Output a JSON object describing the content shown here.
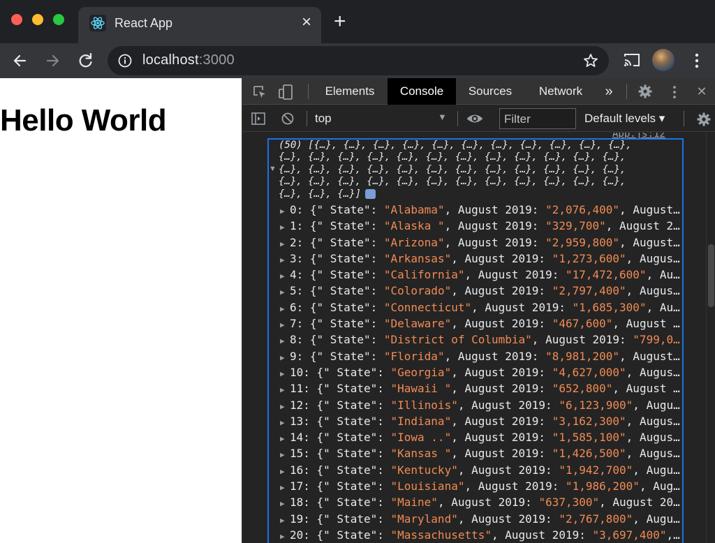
{
  "window": {
    "traffic_colors": [
      "#ff5f57",
      "#febc2e",
      "#28c840"
    ]
  },
  "tab": {
    "title": "React App",
    "close_glyph": "×",
    "icon": "react-logo-icon"
  },
  "new_tab_glyph": "+",
  "address": {
    "host": "localhost",
    "port": ":3000"
  },
  "page": {
    "heading": "Hello World"
  },
  "devtools": {
    "tabs": [
      "Elements",
      "Console",
      "Sources",
      "Network"
    ],
    "active_tab": "Console",
    "more_tabs_glyph": "»",
    "close_glyph": "✕",
    "context": "top",
    "filter_placeholder": "Filter",
    "levels": "Default levels ▾",
    "source_link": "App.js:12"
  },
  "console": {
    "summary_lines": [
      "(50) [{…}, {…}, {…}, {…}, {…}, {…}, {…}, {…}, {…}, {…}, {…},",
      "{…}, {…}, {…}, {…}, {…}, {…}, {…}, {…}, {…}, {…}, {…}, {…},",
      "{…}, {…}, {…}, {…}, {…}, {…}, {…}, {…}, {…}, {…}, {…}, {…},",
      "{…}, {…}, {…}, {…}, {…}, {…}, {…}, {…}, {…}, {…}, {…}, {…},",
      "{…}, {…}, {…}]"
    ],
    "rows": [
      {
        "index": "0",
        "state": "\"Alabama\"",
        "value": "\"2,076,400\"",
        "tail": ", August…"
      },
      {
        "index": "1",
        "state": "\"Alaska \"",
        "value": "\"329,700\"",
        "tail": ", August 2…"
      },
      {
        "index": "2",
        "state": "\"Arizona\"",
        "value": "\"2,959,800\"",
        "tail": ", August…"
      },
      {
        "index": "3",
        "state": "\"Arkansas\"",
        "value": "\"1,273,600\"",
        "tail": ", Augus…"
      },
      {
        "index": "4",
        "state": "\"California\"",
        "value": "\"17,472,600\"",
        "tail": ", Au…"
      },
      {
        "index": "5",
        "state": "\"Colorado\"",
        "value": "\"2,797,400\"",
        "tail": ", Augus…"
      },
      {
        "index": "6",
        "state": "\"Connecticut\"",
        "value": "\"1,685,300\"",
        "tail": ", Au…"
      },
      {
        "index": "7",
        "state": "\"Delaware\"",
        "value": "\"467,600\"",
        "tail": ", August …"
      },
      {
        "index": "8",
        "state": "\"District of Columbia\"",
        "value": "\"799,0…",
        "tail": ""
      },
      {
        "index": "9",
        "state": "\"Florida\"",
        "value": "\"8,981,200\"",
        "tail": ", August…"
      },
      {
        "index": "10",
        "state": "\"Georgia\"",
        "value": "\"4,627,000\"",
        "tail": ", Augus…"
      },
      {
        "index": "11",
        "state": "\"Hawaii \"",
        "value": "\"652,800\"",
        "tail": ", August …"
      },
      {
        "index": "12",
        "state": "\"Illinois\"",
        "value": "\"6,123,900\"",
        "tail": ", Augu…"
      },
      {
        "index": "13",
        "state": "\"Indiana\"",
        "value": "\"3,162,300\"",
        "tail": ", Augus…"
      },
      {
        "index": "14",
        "state": "\"Iowa ..\"",
        "value": "\"1,585,100\"",
        "tail": ", Augus…"
      },
      {
        "index": "15",
        "state": "\"Kansas \"",
        "value": "\"1,426,500\"",
        "tail": ", Augus…"
      },
      {
        "index": "16",
        "state": "\"Kentucky\"",
        "value": "\"1,942,700\"",
        "tail": ", Augu…"
      },
      {
        "index": "17",
        "state": "\"Louisiana\"",
        "value": "\"1,986,200\"",
        "tail": ", Aug…"
      },
      {
        "index": "18",
        "state": "\"Maine\"",
        "value": "\"637,300\"",
        "tail": ", August 20…"
      },
      {
        "index": "19",
        "state": "\"Maryland\"",
        "value": "\"2,767,800\"",
        "tail": ", Augu…"
      },
      {
        "index": "20",
        "state": "\"Massachusetts\"",
        "value": "\"3,697,400\"",
        "tail": ",…"
      }
    ],
    "key_label": "{\" State\": ",
    "mid_label": ", August 2019: "
  }
}
